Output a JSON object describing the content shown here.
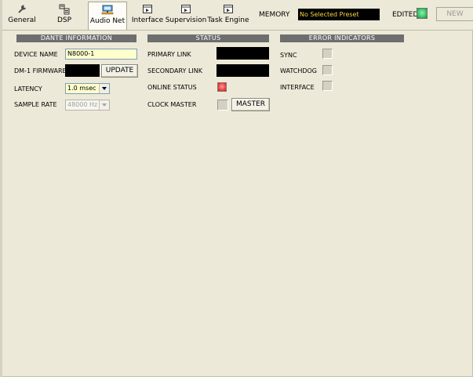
{
  "toolbar": {
    "tabs": [
      {
        "label": "General",
        "icon": "wrench-icon"
      },
      {
        "label": "DSP",
        "icon": "dsp-icon"
      },
      {
        "label": "Audio Net",
        "icon": "network-icon",
        "active": true
      },
      {
        "label": "Interface",
        "icon": "panel-icon"
      },
      {
        "label": "Supervision",
        "icon": "panel-icon"
      },
      {
        "label": "Task Engine",
        "icon": "panel-icon"
      }
    ],
    "memory_label": "MEMORY",
    "memory_value": "No Selected Preset",
    "edited_label": "EDITED",
    "new_label": "NEW"
  },
  "dante": {
    "title": "DANTE INFORMATION",
    "device_name_label": "DEVICE NAME",
    "device_name_value": "N8000-1",
    "firmware_label": "DM-1 FIRMWARE",
    "update_label": "UPDATE",
    "latency_label": "LATENCY",
    "latency_value": "1.0 msec",
    "sample_rate_label": "SAMPLE RATE",
    "sample_rate_value": "48000 Hz"
  },
  "status": {
    "title": "STATUS",
    "primary_link_label": "PRIMARY LINK",
    "secondary_link_label": "SECONDARY LINK",
    "online_status_label": "ONLINE STATUS",
    "clock_master_label": "CLOCK MASTER",
    "master_label": "MASTER"
  },
  "errors": {
    "title": "ERROR INDICATORS",
    "sync_label": "SYNC",
    "watchdog_label": "WATCHDOG",
    "interface_label": "INTERFACE"
  },
  "colors": {
    "background": "#ece9d8",
    "header_bar": "#6e6e6e",
    "memory_text": "#f6d53f",
    "edited_led": "#3ecb6a",
    "online_led": "#ef4a4a",
    "input_bg": "#ffffcc"
  }
}
